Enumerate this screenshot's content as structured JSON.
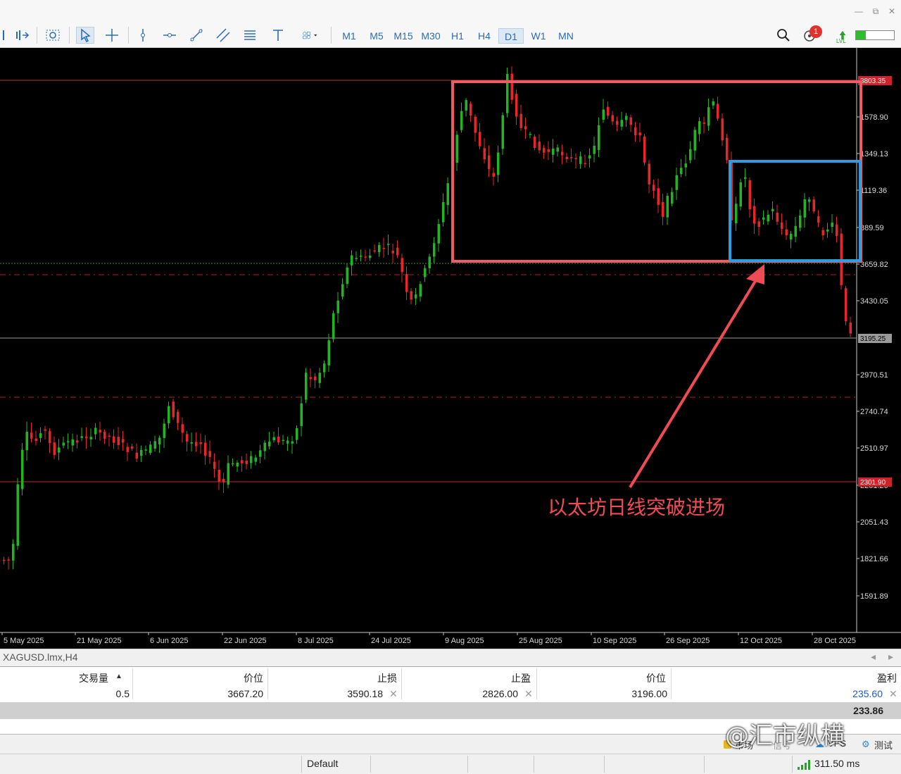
{
  "window": {
    "minimize": "—",
    "restore": "⧉",
    "close": "✕"
  },
  "toolbar": {
    "timeframes": [
      "M1",
      "M5",
      "M15",
      "M30",
      "H1",
      "H4",
      "D1",
      "W1",
      "MN"
    ],
    "active_timeframe": "D1",
    "notification_count": "1",
    "lvl_label": "LVL"
  },
  "chart": {
    "price_labels": [
      "1578.90",
      "1349.13",
      "1119.36",
      "889.59",
      "3659.82",
      "3430.05",
      "2970.51",
      "2740.74",
      "2510.97",
      "2281.20",
      "2051.43",
      "1821.66",
      "1591.89"
    ],
    "level_top_label": "3803.35",
    "current_price_label": "3195.25",
    "level_bottom_label": "2301.90",
    "date_labels": [
      "5 May 2025",
      "21 May 2025",
      "6 Jun 2025",
      "22 Jun 2025",
      "8 Jul 2025",
      "24 Jul 2025",
      "9 Aug 2025",
      "25 Aug 2025",
      "10 Sep 2025",
      "26 Sep 2025",
      "12 Oct 2025",
      "28 Oct 2025"
    ],
    "annotation": "以太坊日线突破进场",
    "colors": {
      "up": "#22b422",
      "down": "#e8252a",
      "red_box": "#f05a64",
      "blue_box": "#2f9be0",
      "arrow": "#ef4b55"
    }
  },
  "symbol_bar": {
    "label": "XAGUSD.lmx,H4",
    "left_arrow": "◂",
    "right_arrow": "▸"
  },
  "trade": {
    "headers": [
      "交易量",
      "价位",
      "止损",
      "止盈",
      "价位",
      "盈利"
    ],
    "sort_indicator": "▲",
    "row": {
      "volume": "0.5",
      "open_price": "3667.20",
      "sl": "3590.18",
      "tp": "2826.00",
      "price": "3196.00",
      "profit": "235.60"
    },
    "balance": "233.86"
  },
  "tabs": {
    "items": [
      "市场",
      "信号",
      "VPS",
      "测试"
    ]
  },
  "watermark": "@汇市纵横",
  "status": {
    "profile": "Default",
    "ping": "311.50 ms"
  }
}
